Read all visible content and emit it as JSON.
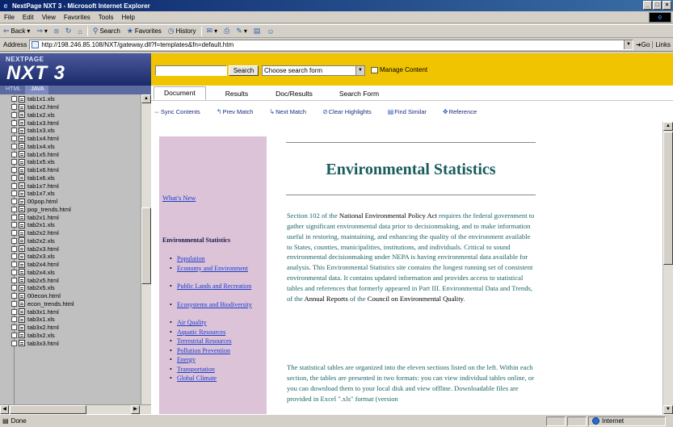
{
  "window": {
    "title": "NextPage NXT 3 - Microsoft Internet Explorer",
    "controls": [
      "_",
      "□",
      "×"
    ]
  },
  "menu": [
    "File",
    "Edit",
    "View",
    "Favorites",
    "Tools",
    "Help"
  ],
  "toolbar": {
    "back": "Back",
    "search": "Search",
    "favorites": "Favorites",
    "history": "History"
  },
  "address": {
    "label": "Address",
    "url": "http://198.246.85.108/NXT/gateway.dll?f=templates&fn=default.htm",
    "go": "Go",
    "links": "Links"
  },
  "left_frame": {
    "logo_small": "NEXTPAGE",
    "logo_big": "NXT 3",
    "tabs": [
      "HTML",
      "JAVA"
    ],
    "tree_items": [
      "tab1x1.xls",
      "tab1x2.html",
      "tab1x2.xls",
      "tab1x3.html",
      "tab1x3.xls",
      "tab1x4.html",
      "tab1x4.xls",
      "tab1x5.html",
      "tab1x5.xls",
      "tab1x6.html",
      "tab1x6.xls",
      "tab1x7.html",
      "tab1x7.xls",
      "00pop.html",
      "pop_trends.html",
      "tab2x1.html",
      "tab2x1.xls",
      "tab2x2.html",
      "tab2x2.xls",
      "tab2x3.html",
      "tab2x3.xls",
      "tab2x4.html",
      "tab2x4.xls",
      "tab2x5.html",
      "tab2x5.xls",
      "00econ.html",
      "econ_trends.html",
      "tab3x1.html",
      "tab3x1.xls",
      "tab3x2.html",
      "tab3x2.xls",
      "tab3x3.html"
    ]
  },
  "search": {
    "button": "Search",
    "select_value": "Choose search form",
    "manage": "Manage Content"
  },
  "tabs": [
    "Document",
    "Results",
    "Doc/Results",
    "Search Form"
  ],
  "actions": [
    "Sync Contents",
    "Prev Match",
    "Next Match",
    "Clear Highlights",
    "Find Similar",
    "Reference"
  ],
  "document": {
    "whats_new": "What's New",
    "section_heading": "Environmental Statistics",
    "nav_items": [
      "Population",
      "Economy and Environment",
      "Public Lands and Recreation",
      "Ecosystems and Biodiversity",
      "Air Quality",
      "Aquatic Resources",
      "Terrestrial Resources",
      "Pollution Prevention",
      "Energy",
      "Transportation",
      "Global Climate"
    ],
    "title": "Environmental Statistics",
    "p1_a": "Section 102 of the ",
    "p1_b": "National Environmental Policy Act",
    "p1_c": " requires the federal government to gather significant environmental data prior to decisionmaking, and to make information useful in restoring, maintaining, and enhancing the quality of the environment available to States, counties, municipalities, institutions, and individuals. Critical to sound environmental decisionmaking under NEPA is having environmental data available for analysis. This Environmental Statistics site contains the longest running set of consistent environmental data. It contains updated information and provides access to statistical tables and references that formerly appeared in Part III. Environmental Data and Trends, of the ",
    "p1_d": "Annual Reports",
    "p1_e": " of the ",
    "p1_f": "Council on Environmental Quality",
    "p1_g": ".",
    "p2": "The statistical tables are organized into the eleven sections listed on the left. Within each section, the tables are presented in two formats: you can view individual tables online, or you can download them to your local disk and view offline. Downloadable files are provided in Excel \".xls\" format (version"
  },
  "status": {
    "text": "Done",
    "zone": "Internet"
  }
}
